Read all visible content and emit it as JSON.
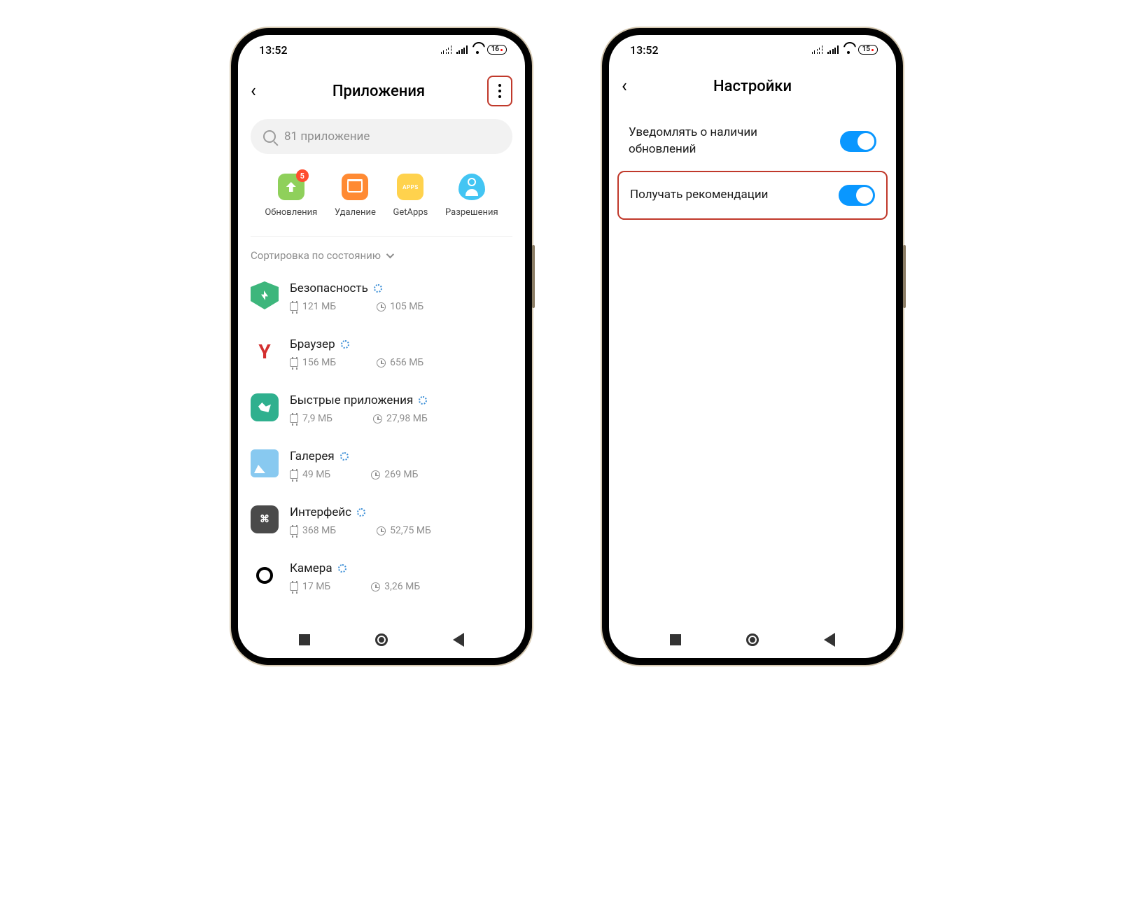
{
  "left": {
    "status": {
      "time": "13:52",
      "battery": "16"
    },
    "header": {
      "title": "Приложения"
    },
    "search": {
      "placeholder": "81 приложение"
    },
    "shortcuts": {
      "update": {
        "label": "Обновления",
        "badge": "5"
      },
      "delete": {
        "label": "Удаление"
      },
      "getapps": {
        "label": "GetApps",
        "icon_text": "APPS"
      },
      "perms": {
        "label": "Разрешения"
      }
    },
    "sort": {
      "label": "Сортировка по состоянию"
    },
    "apps": [
      {
        "name": "Безопасность",
        "storage": "121 МБ",
        "usage": "105 МБ"
      },
      {
        "name": "Браузер",
        "storage": "156 МБ",
        "usage": "656 МБ"
      },
      {
        "name": "Быстрые приложения",
        "storage": "7,9 МБ",
        "usage": "27,98 МБ"
      },
      {
        "name": "Галерея",
        "storage": "49 МБ",
        "usage": "269 МБ"
      },
      {
        "name": "Интерфейс",
        "storage": "368 МБ",
        "usage": "52,75 МБ"
      },
      {
        "name": "Камера",
        "storage": "17 МБ",
        "usage": "3,26 МБ"
      }
    ]
  },
  "right": {
    "status": {
      "time": "13:52",
      "battery": "15"
    },
    "header": {
      "title": "Настройки"
    },
    "settings": {
      "notify_updates": {
        "label": "Уведомлять о наличии обновлений",
        "on": true
      },
      "recommendations": {
        "label": "Получать рекомендации",
        "on": true
      }
    }
  }
}
